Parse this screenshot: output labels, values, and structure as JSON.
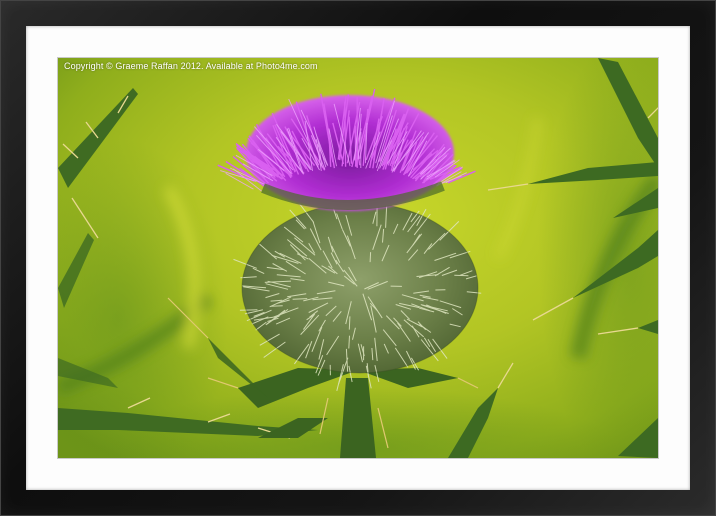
{
  "photo": {
    "watermark": "Copyright © Graeme Raffan 2012. Available at Photo4me.com",
    "subject_icon": "thistle-flower-icon"
  },
  "colors": {
    "frame": "#1a1a1a",
    "mount": "#fdfdfd",
    "background_green": "#b5c823",
    "petal_purple": "#b12ed3",
    "bud_green": "#6f8a45",
    "leaf_green": "#3f6b22"
  }
}
